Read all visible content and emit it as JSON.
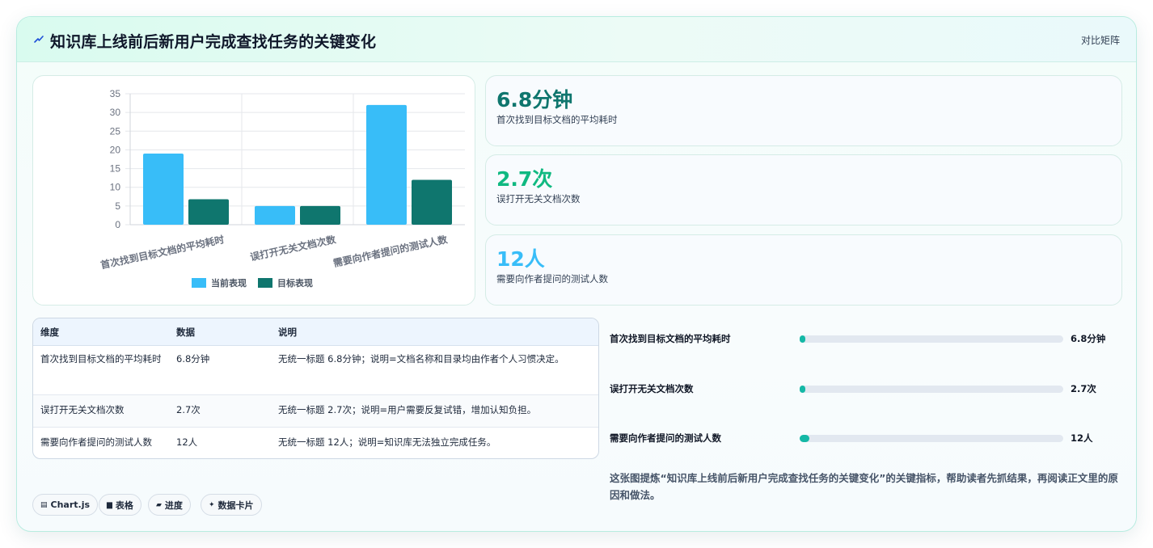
{
  "header": {
    "icon": "lightning-icon",
    "title": "知识库上线前后新用户完成查找任务的关键变化",
    "right_label": "对比矩阵"
  },
  "colors": {
    "current": "#38bdf8",
    "target": "#0f766e",
    "stat1": "#0f766e",
    "stat2": "#10b981",
    "stat3": "#38bdf8",
    "progress": "#14b8a6"
  },
  "chart_data": {
    "type": "bar",
    "categories": [
      "首次找到目标文档的平均耗时",
      "误打开无关文档次数",
      "需要向作者提问的测试人数"
    ],
    "series": [
      {
        "name": "当前表现",
        "values": [
          19,
          5,
          32
        ]
      },
      {
        "name": "目标表现",
        "values": [
          6.8,
          5,
          12
        ]
      }
    ],
    "ylim": [
      0,
      35
    ],
    "yticks": [
      0,
      5,
      10,
      15,
      20,
      25,
      30,
      35
    ],
    "grid": true,
    "legend": "bottom",
    "title": "",
    "xlabel": "",
    "ylabel": ""
  },
  "stats": [
    {
      "value": "6.8分钟",
      "label": "首次找到目标文档的平均耗时"
    },
    {
      "value": "2.7次",
      "label": "误打开无关文档次数"
    },
    {
      "value": "12人",
      "label": "需要向作者提问的测试人数"
    }
  ],
  "table": {
    "headers": [
      "维度",
      "数据",
      "说明"
    ],
    "rows": [
      [
        "首次找到目标文档的平均耗时",
        "6.8分钟",
        "无统一标题 6.8分钟；说明=文档名称和目录均由作者个人习惯决定。"
      ],
      [
        "误打开无关文档次数",
        "2.7次",
        "无统一标题 2.7次；说明=用户需要反复试错，增加认知负担。"
      ],
      [
        "需要向作者提问的测试人数",
        "12人",
        "无统一标题 12人；说明=知识库无法独立完成任务。"
      ]
    ]
  },
  "progress": [
    {
      "label": "首次找到目标文档的平均耗时",
      "value": "6.8分钟",
      "fraction": 0.021
    },
    {
      "label": "误打开无关文档次数",
      "value": "2.7次",
      "fraction": 0.02
    },
    {
      "label": "需要向作者提问的测试人数",
      "value": "12人",
      "fraction": 0.037
    }
  ],
  "note": "这张图提炼“知识库上线前后新用户完成查找任务的关键变化”的关键指标，帮助读者先抓结果，再阅读正文里的原因和做法。",
  "chips": [
    {
      "icon": "chart-icon",
      "glyph": "▤",
      "label": "Chart.js"
    },
    {
      "icon": "table-icon",
      "glyph": "▆",
      "label": "表格"
    },
    {
      "icon": "progress-icon",
      "glyph": "▰",
      "label": "进度"
    },
    {
      "icon": "sparkle-icon",
      "glyph": "✦",
      "label": "数据卡片"
    }
  ]
}
